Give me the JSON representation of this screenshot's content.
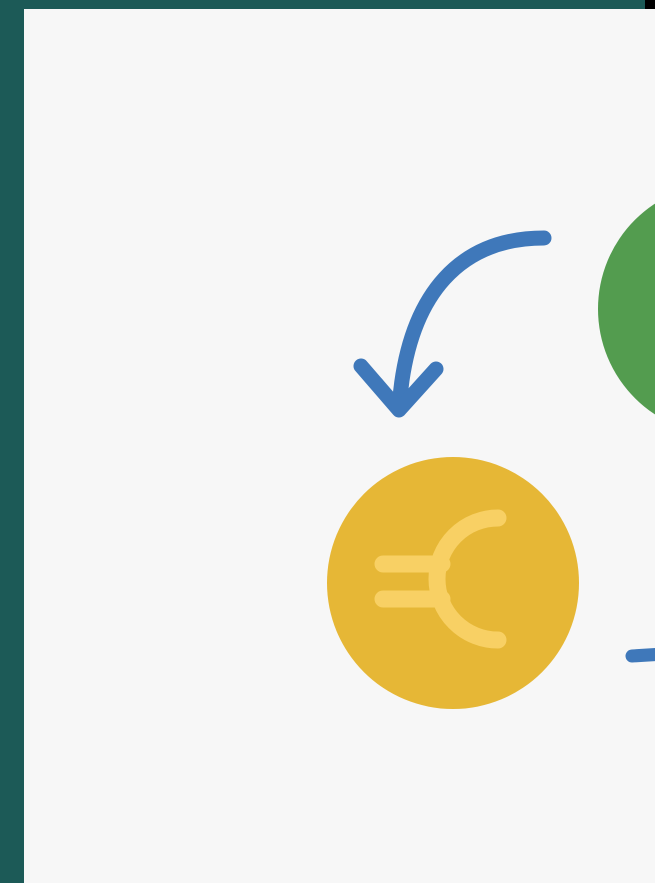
{
  "illustration": {
    "coin_left": {
      "symbol": "€",
      "icon": "euro-coin-icon"
    },
    "coin_right": {
      "icon": "green-coin-icon"
    },
    "arrows": [
      "curved-arrow-icon",
      "arrow-icon"
    ]
  },
  "colors": {
    "border": "#1c5a57",
    "background": "#f7f7f7",
    "coin_gold": "#e6b736",
    "coin_gold_symbol": "#f8d064",
    "coin_green": "#539c4f",
    "arrow_blue": "#3f78ba"
  }
}
